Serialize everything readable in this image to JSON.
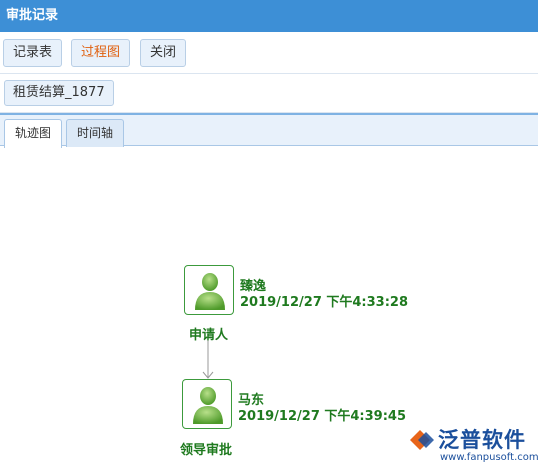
{
  "window": {
    "title": "审批记录"
  },
  "toolbar": {
    "record_table_label": "记录表",
    "process_chart_label": "过程图",
    "close_label": "关闭"
  },
  "document": {
    "name": "租赁结算_1877"
  },
  "tabs": [
    {
      "label": "轨迹图",
      "active": true
    },
    {
      "label": "时间轴",
      "active": false
    }
  ],
  "flow": {
    "nodes": [
      {
        "person": "臻逸",
        "time": "2019/12/27 下午4:33:28",
        "role": "申请人"
      },
      {
        "person": "马东",
        "time": "2019/12/27 下午4:39:45",
        "role": "领导审批"
      }
    ]
  },
  "watermark": {
    "brand": "泛普软件",
    "url": "www.fanpusoft.com"
  },
  "colors": {
    "titlebar": "#3d8fd6",
    "node_text": "#1f7a1f",
    "active_button_text": "#e0600f",
    "brand": "#1b4f9c"
  },
  "icons": {
    "node": "user-avatar-icon",
    "arrow": "down-arrow-connector",
    "logo": "fanpu-logo-icon"
  }
}
